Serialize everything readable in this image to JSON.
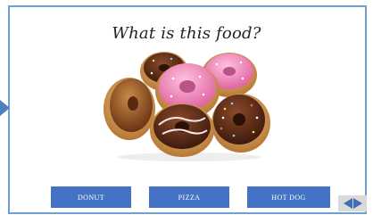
{
  "question": "What is this food?",
  "image": {
    "icon": "donuts-image",
    "description_colors": {
      "pink_frosting": "#f08fbd",
      "chocolate": "#5a2a16",
      "dough": "#d9a25e"
    }
  },
  "answers": [
    {
      "label": "DONUT"
    },
    {
      "label": "PIZZA"
    },
    {
      "label": "HOT DOG"
    }
  ],
  "colors": {
    "frame": "#6fa0d3",
    "button": "#4472c4",
    "nav_arrow": "#3f6fb0"
  },
  "navigation": {
    "prev_icon": "arrow-left-icon",
    "next_icon": "arrow-right-icon"
  }
}
